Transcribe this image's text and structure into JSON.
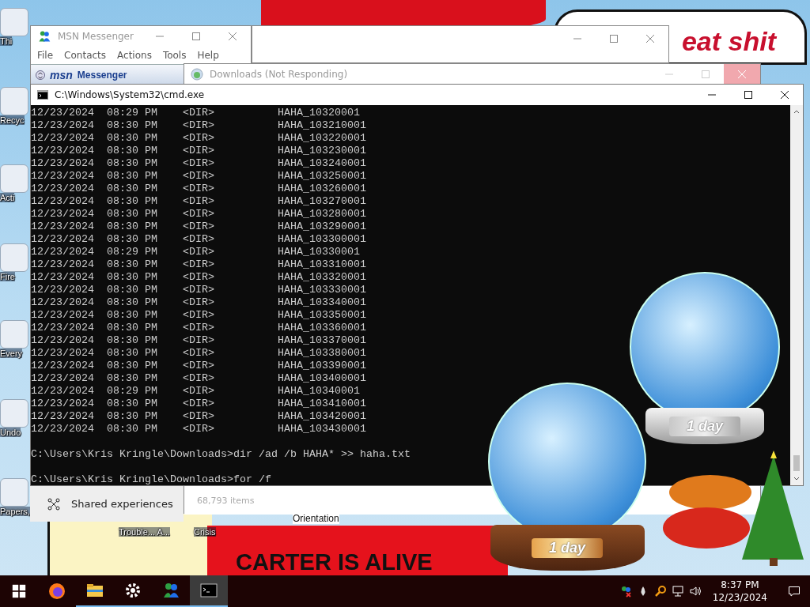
{
  "desktop_icons": [
    {
      "label": "Thi"
    },
    {
      "label": "Recyc"
    },
    {
      "label": "Acti"
    },
    {
      "label": "Fire"
    },
    {
      "label": "Every"
    },
    {
      "label": "Undo"
    },
    {
      "label": "Papers,"
    },
    {
      "label": "Trouble... A..."
    },
    {
      "label": "Crisis"
    },
    {
      "label": "Orientation"
    }
  ],
  "wallpaper": {
    "speech_bubble": "eat shit",
    "banner_lines": [
      "CARTER IS ALIVE"
    ]
  },
  "msn_window": {
    "title": "MSN Messenger",
    "menu": [
      "File",
      "Contacts",
      "Actions",
      "Tools",
      "Help"
    ],
    "brand": "msn",
    "brand_product": "Messenger"
  },
  "downloads_window": {
    "title": "Downloads (Not Responding)",
    "status": "68,793 items"
  },
  "settings_panel": {
    "item": "Shared experiences"
  },
  "cmd_window": {
    "title": "C:\\Windows\\System32\\cmd.exe",
    "lines": [
      "12/23/2024  08:29 PM    <DIR>          HAHA_10320001",
      "12/23/2024  08:30 PM    <DIR>          HAHA_103210001",
      "12/23/2024  08:30 PM    <DIR>          HAHA_103220001",
      "12/23/2024  08:30 PM    <DIR>          HAHA_103230001",
      "12/23/2024  08:30 PM    <DIR>          HAHA_103240001",
      "12/23/2024  08:30 PM    <DIR>          HAHA_103250001",
      "12/23/2024  08:30 PM    <DIR>          HAHA_103260001",
      "12/23/2024  08:30 PM    <DIR>          HAHA_103270001",
      "12/23/2024  08:30 PM    <DIR>          HAHA_103280001",
      "12/23/2024  08:30 PM    <DIR>          HAHA_103290001",
      "12/23/2024  08:30 PM    <DIR>          HAHA_103300001",
      "12/23/2024  08:29 PM    <DIR>          HAHA_10330001",
      "12/23/2024  08:30 PM    <DIR>          HAHA_103310001",
      "12/23/2024  08:30 PM    <DIR>          HAHA_103320001",
      "12/23/2024  08:30 PM    <DIR>          HAHA_103330001",
      "12/23/2024  08:30 PM    <DIR>          HAHA_103340001",
      "12/23/2024  08:30 PM    <DIR>          HAHA_103350001",
      "12/23/2024  08:30 PM    <DIR>          HAHA_103360001",
      "12/23/2024  08:30 PM    <DIR>          HAHA_103370001",
      "12/23/2024  08:30 PM    <DIR>          HAHA_103380001",
      "12/23/2024  08:30 PM    <DIR>          HAHA_103390001",
      "12/23/2024  08:30 PM    <DIR>          HAHA_103400001",
      "12/23/2024  08:29 PM    <DIR>          HAHA_10340001",
      "12/23/2024  08:30 PM    <DIR>          HAHA_103410001",
      "12/23/2024  08:30 PM    <DIR>          HAHA_103420001",
      "12/23/2024  08:30 PM    <DIR>          HAHA_103430001"
    ],
    "prompts": [
      "C:\\Users\\Kris Kringle\\Downloads>dir /ad /b HAHA* >> haha.txt",
      "C:\\Users\\Kris Kringle\\Downloads>for /f"
    ]
  },
  "gadgets": [
    {
      "label": "1 day"
    },
    {
      "label": "1 day"
    }
  ],
  "taskbar": {
    "apps": [
      {
        "running": false,
        "selected": false
      },
      {
        "running": true,
        "selected": false
      },
      {
        "running": true,
        "selected": false
      },
      {
        "running": true,
        "selected": false
      },
      {
        "running": true,
        "selected": true
      }
    ],
    "time": "8:37 PM",
    "date": "12/23/2024"
  }
}
